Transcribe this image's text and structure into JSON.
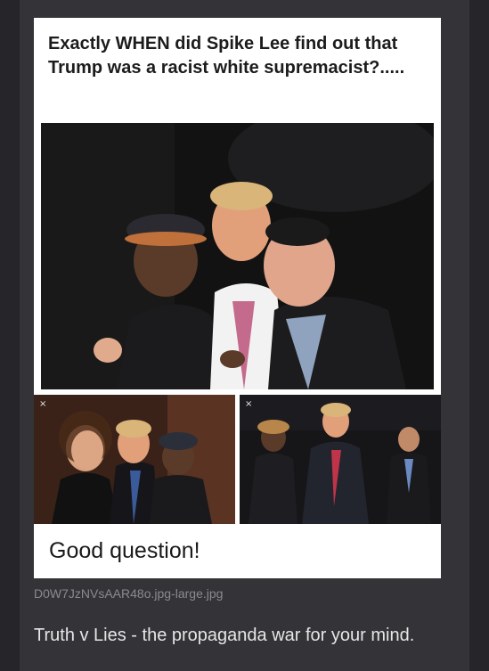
{
  "post": {
    "image": {
      "headline": "Exactly WHEN did Spike Lee find out that Trump was a racist white supremacist?.....",
      "caption": "Good question!",
      "close_glyph": "×"
    },
    "filename": "D0W7JzNVsAAR48o.jpg-large.jpg",
    "body_text": "Truth v Lies - the propaganda war for your mind."
  }
}
